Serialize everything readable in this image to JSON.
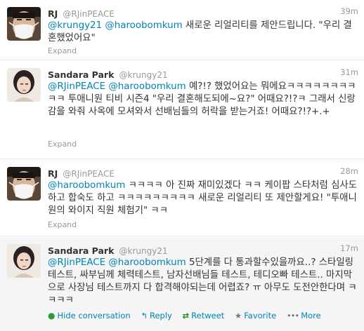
{
  "tweets": [
    {
      "fullname": "RJ",
      "username": "@RJinPEACE",
      "time": "39m",
      "mentions": [
        "@krungy21",
        "@haroobomkum"
      ],
      "body": "새로운 리얼리티를 제안드립니다. \"우리 결혼했었어요\"",
      "expand": "Expand"
    },
    {
      "fullname": "Sandara Park",
      "username": "@krungy21",
      "time": "31m",
      "mentions": [
        "@RJinPEACE",
        "@haroobomkum"
      ],
      "body": "예?!? 했었어요는 뭐에요ㅋㅋㅋㅋㅋㅋㅋㅋㅋㅋ 투애니원 티비 시즌4 \"우리 결혼해도되에~요?\" 어때요?!?ㅋ 그래서 신랑감을 와줘 사옥에 모셔와서 선배님들의 허락을 받는거죠! 어때요?!?+.+",
      "expand": "Expand"
    },
    {
      "fullname": "RJ",
      "username": "@RJinPEACE",
      "time": "28m",
      "mentions": [
        "@haroobomkum"
      ],
      "body": "ㅋㅋㅋㅋ 아 진짜 재미있겠다 ㅋㅋ 케이팝 스타처럼 심사도 하고 합숙도 하고 ㅋㅋㅋㅋㅋㅋㅋㅋㅋ 새로운 리얼리티 또 제안할게요! \"투애니원의 와이지 직원 체험기\" ㅋㅋ",
      "expand": "Expand"
    },
    {
      "fullname": "Sandara Park",
      "username": "@krungy21",
      "time": "17m",
      "mentions": [
        "@RJinPEACE",
        "@haroobomkum"
      ],
      "body": "5단계를 다 통과할수있을까요..? 스타일링 테스트, 싸부님께 체력테스트, 남자선배님들 테스트, 테디오빠 테스트.. 마지막으로 사장님 테스트까지 다 합격해야되는데 어렵죠? ㅠ 아무도 도전안한다며 ㅋㅋㅋㅋ",
      "actions": {
        "hide": "Hide conversation",
        "reply": "Reply",
        "retweet": "Retweet",
        "favorite": "Favorite",
        "more": "More"
      }
    }
  ],
  "colors": {
    "link": "#0084b4",
    "text": "#333333",
    "meta": "#999999",
    "divider": "#e8e8e8",
    "expanded_bg": "#f5f5f5"
  },
  "icons": [
    "hide-conversation-icon",
    "reply-icon",
    "retweet-icon",
    "favorite-star-icon",
    "more-dots-icon"
  ]
}
